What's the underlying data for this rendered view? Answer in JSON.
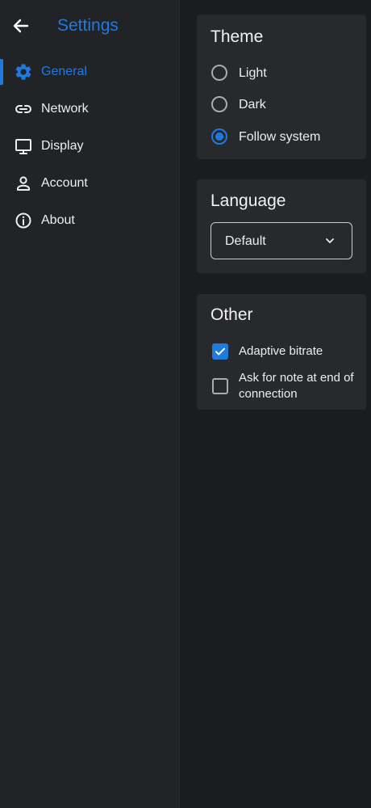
{
  "header": {
    "title": "Settings",
    "back_icon": "arrow-left-icon"
  },
  "accent_color": "#1f7ae0",
  "sidebar": {
    "items": [
      {
        "label": "General",
        "icon": "gear-icon",
        "active": true
      },
      {
        "label": "Network",
        "icon": "link-icon",
        "active": false
      },
      {
        "label": "Display",
        "icon": "monitor-icon",
        "active": false
      },
      {
        "label": "Account",
        "icon": "person-icon",
        "active": false
      },
      {
        "label": "About",
        "icon": "info-icon",
        "active": false
      }
    ]
  },
  "theme": {
    "title": "Theme",
    "options": [
      {
        "label": "Light",
        "selected": false
      },
      {
        "label": "Dark",
        "selected": false
      },
      {
        "label": "Follow system",
        "selected": true
      }
    ]
  },
  "language": {
    "title": "Language",
    "value": "Default"
  },
  "other": {
    "title": "Other",
    "options": [
      {
        "label": "Adaptive bitrate",
        "checked": true
      },
      {
        "label": "Ask for note at end of connection",
        "checked": false
      }
    ]
  }
}
